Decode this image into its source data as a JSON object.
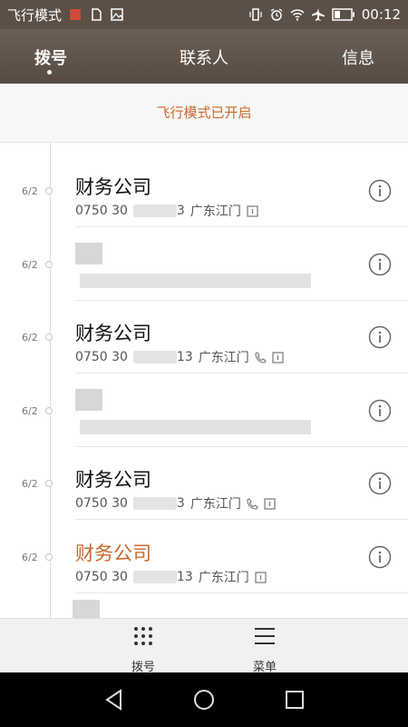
{
  "status": {
    "mode_label": "飞行模式",
    "time": "00:12"
  },
  "tabs": [
    {
      "label": "拨号",
      "active": true
    },
    {
      "label": "联系人",
      "active": false
    },
    {
      "label": "信息",
      "active": false
    }
  ],
  "banner": "飞行模式已开启",
  "calls": [
    {
      "date": "6/2",
      "name": "财务公司",
      "number": "0750 30",
      "number_end": "3",
      "location": "广东江门",
      "missed": false,
      "blurred": false
    },
    {
      "date": "6/2",
      "name": "",
      "number": "",
      "number_end": "",
      "location": "",
      "missed": false,
      "blurred": true
    },
    {
      "date": "6/2",
      "name": "财务公司",
      "number": "0750 30",
      "number_end": "13",
      "location": "广东江门",
      "missed": false,
      "blurred": false
    },
    {
      "date": "6/2",
      "name": "",
      "number": "",
      "number_end": "",
      "location": "",
      "missed": false,
      "blurred": true
    },
    {
      "date": "6/2",
      "name": "财务公司",
      "number": "0750 30",
      "number_end": "3",
      "location": "广东江门",
      "missed": false,
      "blurred": false
    },
    {
      "date": "6/2",
      "name": "财务公司",
      "number": "0750 30",
      "number_end": "13",
      "location": "广东江门",
      "missed": true,
      "blurred": false
    }
  ],
  "bottom": {
    "dialpad_label": "拨号",
    "menu_label": "菜单"
  },
  "colors": {
    "accent": "#c9692d",
    "header": "#5b4f46"
  },
  "icons": [
    "airplane-mode-icon",
    "battery-icon",
    "wifi-icon",
    "alarm-icon",
    "info-icon",
    "sim-icon",
    "call-icon",
    "dialpad-icon",
    "menu-icon",
    "back-icon",
    "home-icon",
    "recents-icon"
  ]
}
